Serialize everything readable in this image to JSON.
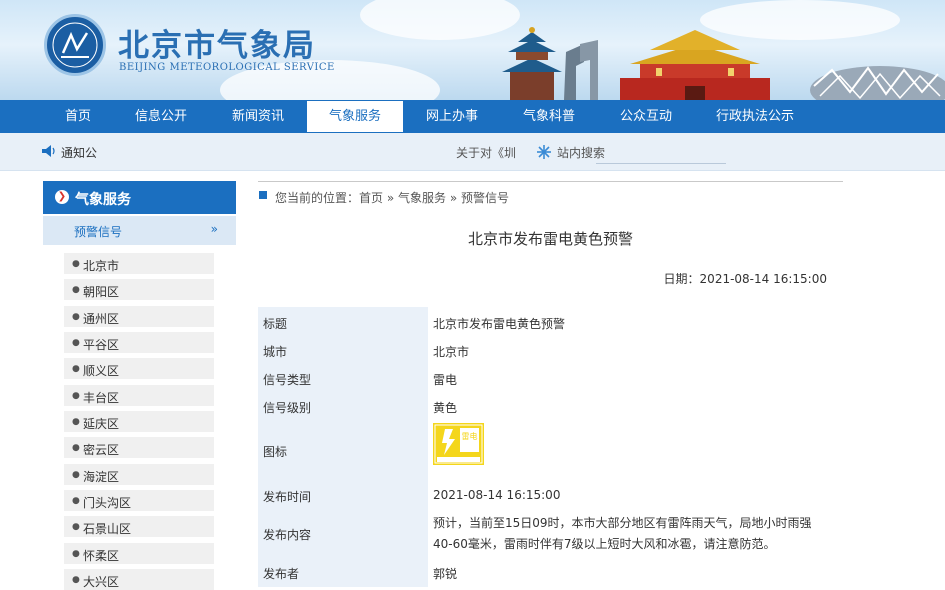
{
  "header": {
    "title": "北京市气象局",
    "subtitle": "BEIJING METEOROLOGICAL SERVICE"
  },
  "nav": {
    "items": [
      "首页",
      "信息公开",
      "新闻资讯",
      "气象服务",
      "网上办事",
      "气象科普",
      "公众互动",
      "行政执法公示"
    ],
    "active_index": 3
  },
  "notice": {
    "label": "通知公",
    "ticker_text": "关于对《圳",
    "search_link": "站内搜索"
  },
  "sidebar": {
    "title": "气象服务",
    "active_sub": "预警信号",
    "arrow": "»",
    "districts": [
      "北京市",
      "朝阳区",
      "通州区",
      "平谷区",
      "顺义区",
      "丰台区",
      "延庆区",
      "密云区",
      "海淀区",
      "门头沟区",
      "石景山区",
      "怀柔区",
      "大兴区"
    ]
  },
  "breadcrumb": {
    "prefix": "您当前的位置：",
    "items": [
      "首页",
      "气象服务",
      "预警信号"
    ],
    "separator": "»"
  },
  "article": {
    "title": "北京市发布雷电黄色预警",
    "date_label": "日期：",
    "date": "2021-08-14 16:15:00"
  },
  "table": {
    "rows": [
      {
        "label": "标题",
        "value": "北京市发布雷电黄色预警"
      },
      {
        "label": "城市",
        "value": "北京市"
      },
      {
        "label": "信号类型",
        "value": "雷电"
      },
      {
        "label": "信号级别",
        "value": "黄色"
      },
      {
        "label": "图标",
        "value": ""
      },
      {
        "label": "发布时间",
        "value": "2021-08-14 16:15:00"
      },
      {
        "label": "发布内容",
        "value": "预计，当前至15日09时，本市大部分地区有雷阵雨天气，局地小时雨强40-60毫米，雷雨时伴有7级以上短时大风和冰雹，请注意防范。"
      },
      {
        "label": "发布者",
        "value": "郭锐"
      }
    ],
    "icon_text": "雷电",
    "icon_color": "#f4d61b"
  },
  "colors": {
    "primary": "#1b6fc0",
    "label_bg": "#eaf1f9"
  }
}
